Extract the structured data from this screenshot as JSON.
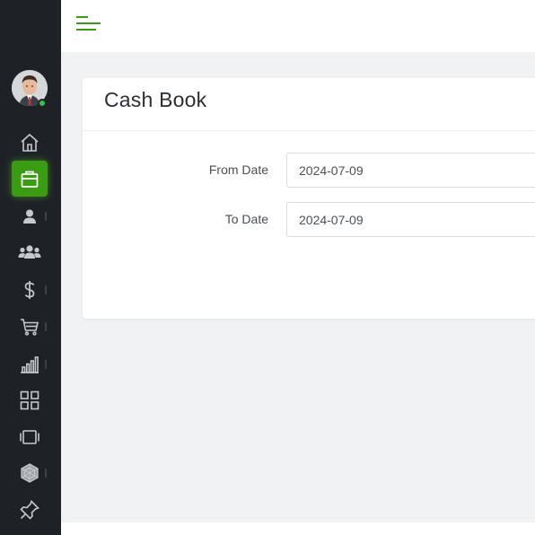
{
  "page": {
    "title": "Cash Book"
  },
  "colors": {
    "accent": "#3a9c12",
    "sidebar_bg": "#1e2227",
    "online": "#3ac04a",
    "icon": "#c5c9ce"
  },
  "sidebar": {
    "items": [
      {
        "icon": "home-icon"
      },
      {
        "icon": "shopping-bag-icon",
        "active": true
      },
      {
        "icon": "user-icon"
      },
      {
        "icon": "users-icon"
      },
      {
        "icon": "dollar-icon"
      },
      {
        "icon": "cart-icon"
      },
      {
        "icon": "bar-chart-icon"
      },
      {
        "icon": "grid-icon"
      },
      {
        "icon": "slides-icon"
      },
      {
        "icon": "hexagon-icon"
      },
      {
        "icon": "pin-icon"
      }
    ]
  },
  "topbar": {
    "menu_icon": "menu-toggle-icon"
  },
  "form": {
    "from_date": {
      "label": "From Date",
      "value": "2024-07-09"
    },
    "to_date": {
      "label": "To Date",
      "value": "2024-07-09"
    }
  }
}
